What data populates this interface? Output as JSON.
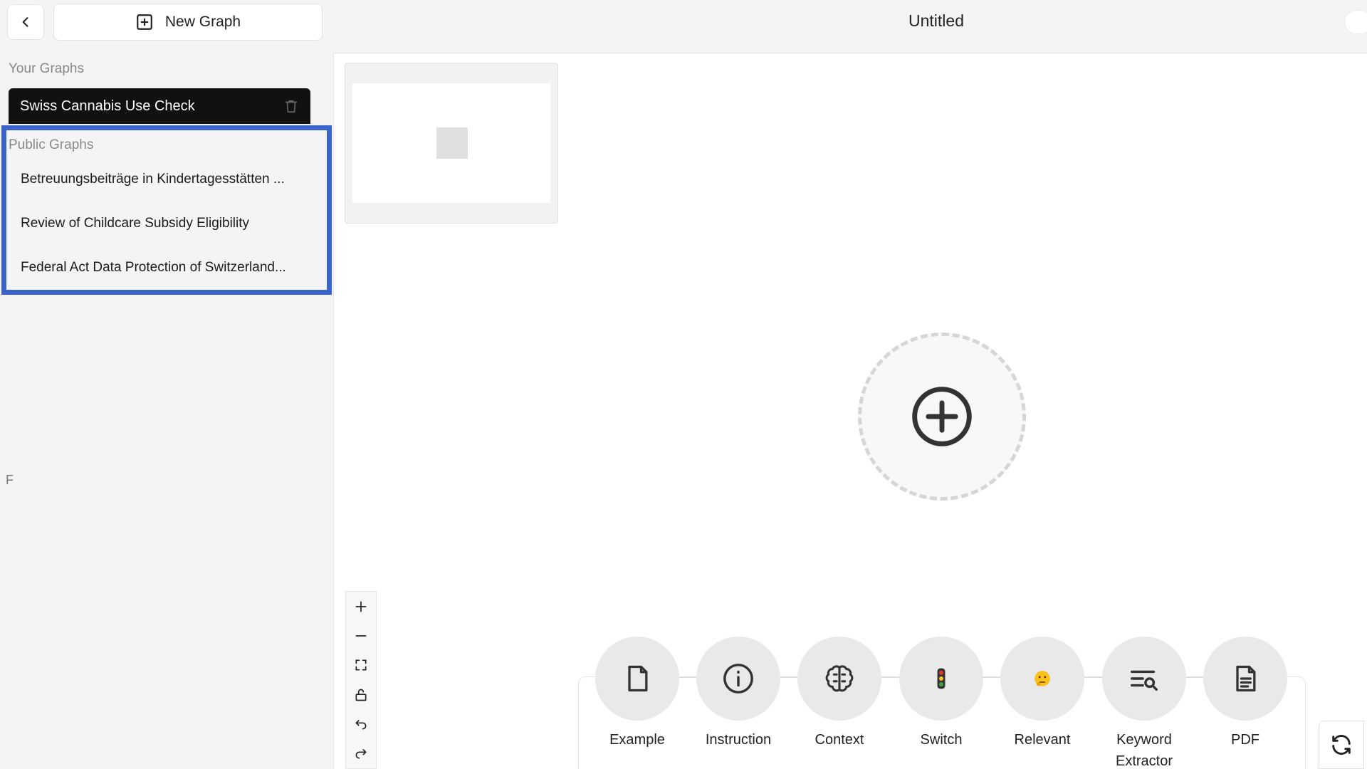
{
  "header": {
    "new_graph_label": "New Graph",
    "title": "Untitled"
  },
  "sidebar": {
    "your_graphs_label": "Your Graphs",
    "your_graphs": [
      {
        "label": "Swiss Cannabis Use Check"
      }
    ],
    "public_graphs_label": "Public Graphs",
    "public_graphs": [
      {
        "label": "Betreuungsbeiträge in Kindertagesstätten ..."
      },
      {
        "label": "Review of Childcare Subsidy Eligibility"
      },
      {
        "label": "Federal Act Data Protection of Switzerland..."
      }
    ],
    "stray_text": "F"
  },
  "canvas": {
    "controls": [
      "plus-icon",
      "minus-icon",
      "fit-view-icon",
      "unlock-icon",
      "undo-icon",
      "redo-icon"
    ]
  },
  "palette": {
    "tools": [
      {
        "label": "Example",
        "icon": "file-icon"
      },
      {
        "label": "Instruction",
        "icon": "info-icon"
      },
      {
        "label": "Context",
        "icon": "brain-icon"
      },
      {
        "label": "Switch",
        "icon": "traffic-light-emoji"
      },
      {
        "label": "Relevant",
        "icon": "thinking-face-emoji"
      },
      {
        "label": "Keyword Extractor",
        "icon": "search-list-icon"
      },
      {
        "label": "PDF",
        "icon": "document-icon"
      }
    ]
  },
  "colors": {
    "highlight_border": "#3a64c9",
    "active_item_bg": "#111111",
    "page_bg": "#f4f4f4"
  }
}
